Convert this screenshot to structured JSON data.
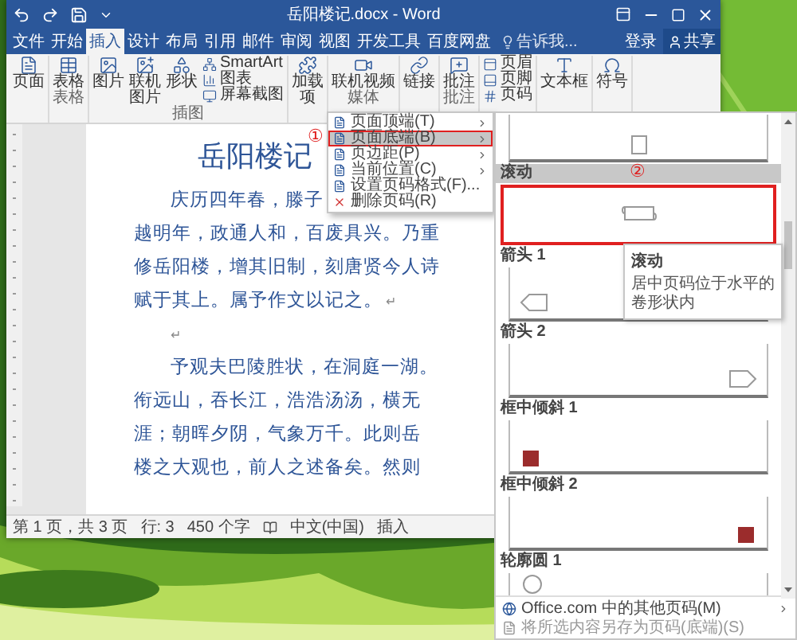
{
  "window": {
    "title": "岳阳楼记.docx - Word",
    "sign_in": "登录",
    "share": "共享"
  },
  "tabs": [
    {
      "label": "文件",
      "selected": false
    },
    {
      "label": "开始",
      "selected": false
    },
    {
      "label": "插入",
      "selected": true
    },
    {
      "label": "设计",
      "selected": false
    },
    {
      "label": "布局",
      "selected": false
    },
    {
      "label": "引用",
      "selected": false
    },
    {
      "label": "邮件",
      "selected": false
    },
    {
      "label": "审阅",
      "selected": false
    },
    {
      "label": "视图",
      "selected": false
    },
    {
      "label": "开发工具",
      "selected": false
    },
    {
      "label": "百度网盘",
      "selected": false
    }
  ],
  "tell_me": {
    "placeholder": "告诉我..."
  },
  "ribbon": [
    {
      "items": [
        {
          "label": "页面",
          "kind": "large"
        }
      ]
    },
    {
      "label": "表格",
      "items": [
        {
          "label": "表格",
          "kind": "large"
        }
      ]
    },
    {
      "label": "插图",
      "items": [
        {
          "label": "图片",
          "kind": "large"
        },
        {
          "label": "联机图片",
          "kind": "large"
        },
        {
          "label": "形状",
          "kind": "large"
        },
        {
          "label": "SmartArt",
          "kind": "small"
        },
        {
          "label": "图表",
          "kind": "small"
        },
        {
          "label": "屏幕截图",
          "kind": "small"
        }
      ]
    },
    {
      "items": [
        {
          "label": "加载项",
          "kind": "large"
        }
      ]
    },
    {
      "label": "媒体",
      "items": [
        {
          "label": "联机视频",
          "kind": "large"
        }
      ]
    },
    {
      "items": [
        {
          "label": "链接",
          "kind": "large"
        }
      ]
    },
    {
      "label": "批注",
      "items": [
        {
          "label": "批注",
          "kind": "large"
        }
      ]
    },
    {
      "items": [
        {
          "label": "页眉",
          "kind": "small"
        },
        {
          "label": "页脚",
          "kind": "small"
        },
        {
          "label": "页码",
          "kind": "small"
        }
      ]
    },
    {
      "items": [
        {
          "label": "文本框",
          "kind": "large"
        }
      ]
    },
    {
      "items": [
        {
          "label": "符号",
          "kind": "large"
        }
      ]
    }
  ],
  "document": {
    "title": "岳阳楼记",
    "paragraphs": [
      {
        "lines": [
          "庆历四年春，滕子",
          "越明年，政通人和，百废具兴。乃重",
          "修岳阳楼，增其旧制，刻唐贤今人诗",
          "赋于其上。属予作文以记之。"
        ],
        "mark": "↵"
      },
      {
        "mark": "↵"
      },
      {
        "lines": [
          "予观夫巴陵胜状，在洞庭一湖。",
          "衔远山，吞长江，浩浩汤汤，横无",
          "涯；朝晖夕阴，气象万千。此则岳",
          "楼之大观也，前人之述备矣。然则"
        ]
      }
    ]
  },
  "status_bar": [
    "第 1 页，共 3 页",
    "行: 3",
    "450 个字",
    "中文(中国)",
    "插入"
  ],
  "page_number_menu": [
    {
      "label": "页面顶端(T)",
      "submenu": true,
      "selected": false
    },
    {
      "label": "页面底端(B)",
      "submenu": true,
      "selected": true
    },
    {
      "label": "页边距(P)",
      "submenu": true,
      "selected": false
    },
    {
      "label": "当前位置(C)",
      "submenu": true,
      "selected": false
    },
    {
      "label": "设置页码格式(F)...",
      "submenu": false,
      "selected": false
    },
    {
      "label": "删除页码(R)",
      "submenu": false,
      "selected": false
    }
  ],
  "gallery": {
    "items": [
      {
        "kind": "center-box",
        "selected": false
      },
      {
        "label": "滚动",
        "kind": "scroll",
        "selected": true
      },
      {
        "label": "箭头 1",
        "kind": "tag-left",
        "selected": false
      },
      {
        "label": "箭头 2",
        "kind": "tag-right",
        "selected": false
      },
      {
        "label": "框中倾斜 1",
        "kind": "box-left",
        "selected": false
      },
      {
        "label": "框中倾斜 2",
        "kind": "box-right",
        "selected": false
      },
      {
        "label": "轮廓圆 1",
        "kind": "circle",
        "selected": false
      }
    ],
    "tooltip": {
      "title": "滚动",
      "text": "居中页码位于水平的卷形状内"
    },
    "footer": [
      {
        "label": "Office.com 中的其他页码(M)",
        "submenu": true,
        "disabled": false
      },
      {
        "label": "将所选内容另存为页码(底端)(S)",
        "submenu": false,
        "disabled": true
      }
    ]
  },
  "callouts": [
    "①",
    "②"
  ]
}
